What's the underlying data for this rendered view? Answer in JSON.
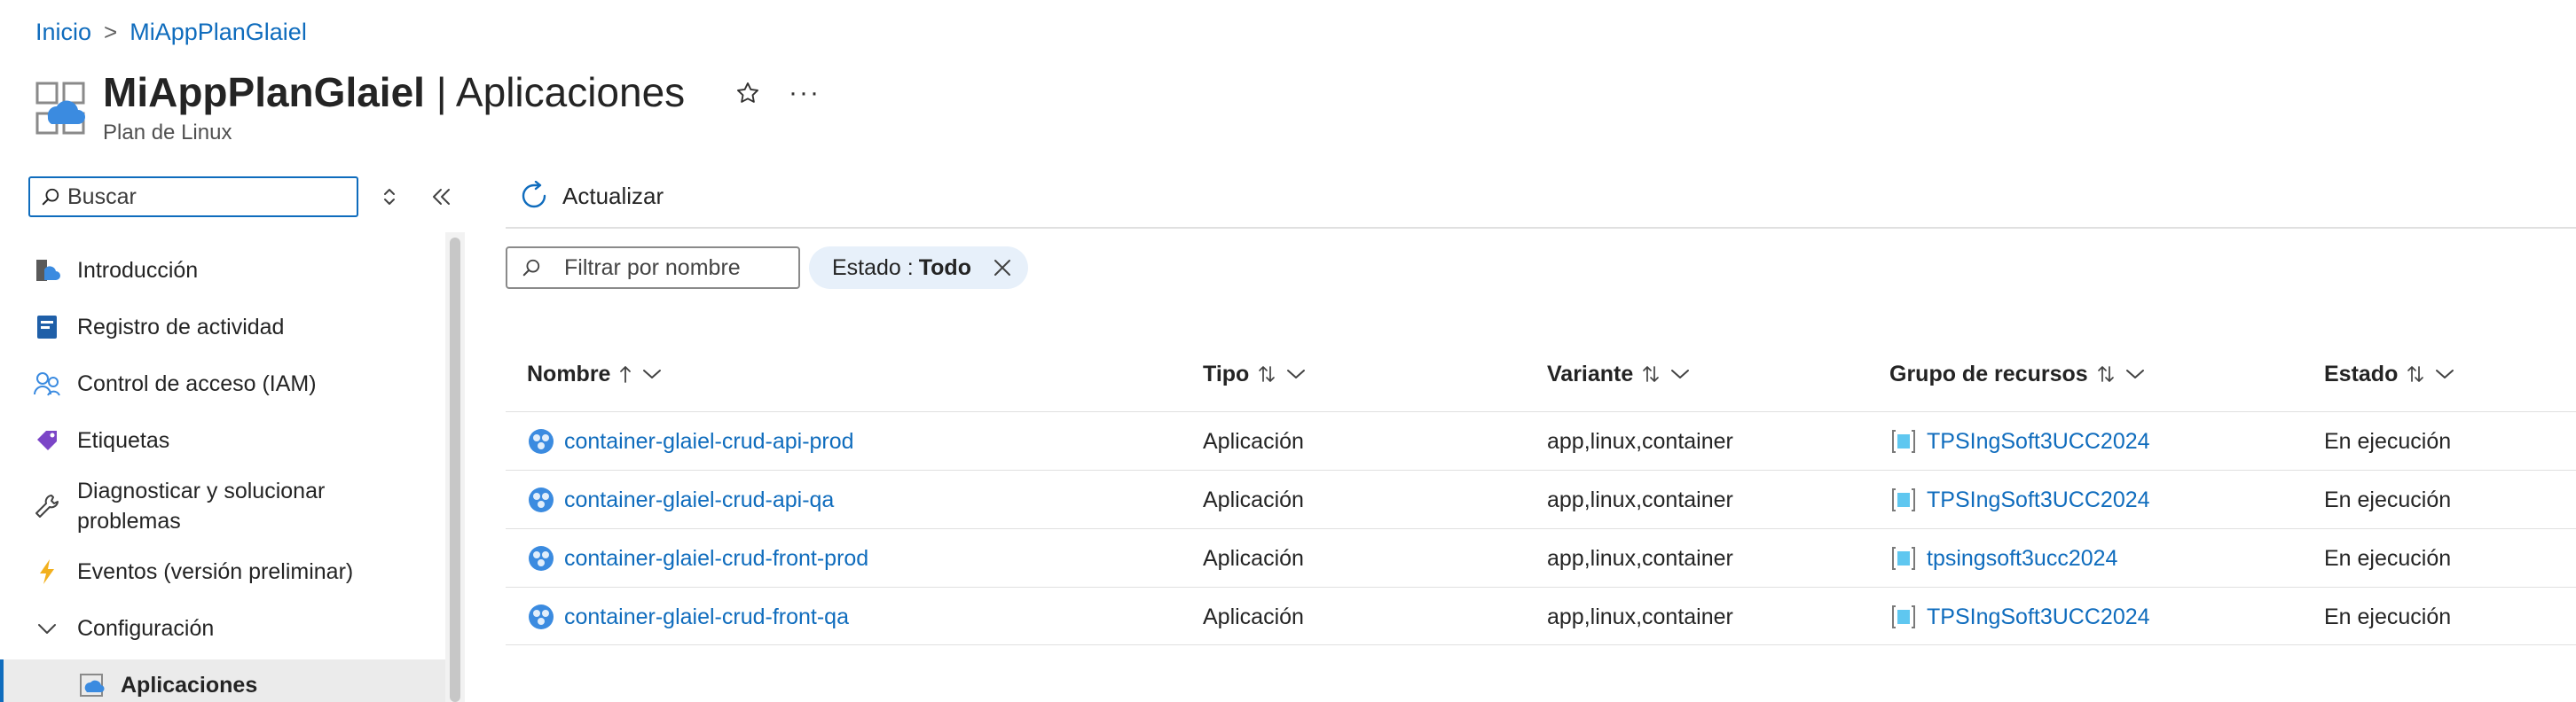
{
  "breadcrumb": {
    "home": "Inicio",
    "separator": ">",
    "current": "MiAppPlanGlaiel"
  },
  "header": {
    "title_strong": "MiAppPlanGlaiel",
    "title_rest": " | Aplicaciones",
    "subtitle": "Plan de Linux",
    "more": "···"
  },
  "sidebar": {
    "search_placeholder": "Buscar",
    "items": [
      {
        "label": "Introducción",
        "icon": "overview-icon"
      },
      {
        "label": "Registro de actividad",
        "icon": "activity-log-icon"
      },
      {
        "label": "Control de acceso (IAM)",
        "icon": "iam-icon"
      },
      {
        "label": "Etiquetas",
        "icon": "tag-icon"
      },
      {
        "label": "Diagnosticar y solucionar problemas",
        "icon": "wrench-icon"
      },
      {
        "label": "Eventos (versión preliminar)",
        "icon": "lightning-icon"
      },
      {
        "label": "Configuración",
        "icon": "chevron-down-icon"
      },
      {
        "label": "Aplicaciones",
        "icon": "app-service-icon",
        "selected": true
      }
    ]
  },
  "toolbar": {
    "refresh_label": "Actualizar"
  },
  "filters": {
    "name_placeholder": "Filtrar por nombre",
    "state_label": "Estado :",
    "state_value": "Todo"
  },
  "table": {
    "columns": [
      "Nombre",
      "Tipo",
      "Variante",
      "Grupo de recursos",
      "Estado"
    ],
    "rows": [
      {
        "name": "container-glaiel-crud-api-prod",
        "type": "Aplicación",
        "variant": "app,linux,container",
        "group": "TPSIngSoft3UCC2024",
        "state": "En ejecución"
      },
      {
        "name": "container-glaiel-crud-api-qa",
        "type": "Aplicación",
        "variant": "app,linux,container",
        "group": "TPSIngSoft3UCC2024",
        "state": "En ejecución"
      },
      {
        "name": "container-glaiel-crud-front-prod",
        "type": "Aplicación",
        "variant": "app,linux,container",
        "group": "tpsingsoft3ucc2024",
        "state": "En ejecución"
      },
      {
        "name": "container-glaiel-crud-front-qa",
        "type": "Aplicación",
        "variant": "app,linux,container",
        "group": "TPSIngSoft3UCC2024",
        "state": "En ejecución"
      }
    ]
  },
  "colors": {
    "accent": "#0f6cbd",
    "pill_bg": "#e7f0fa",
    "selected_bg": "#ebebeb"
  }
}
